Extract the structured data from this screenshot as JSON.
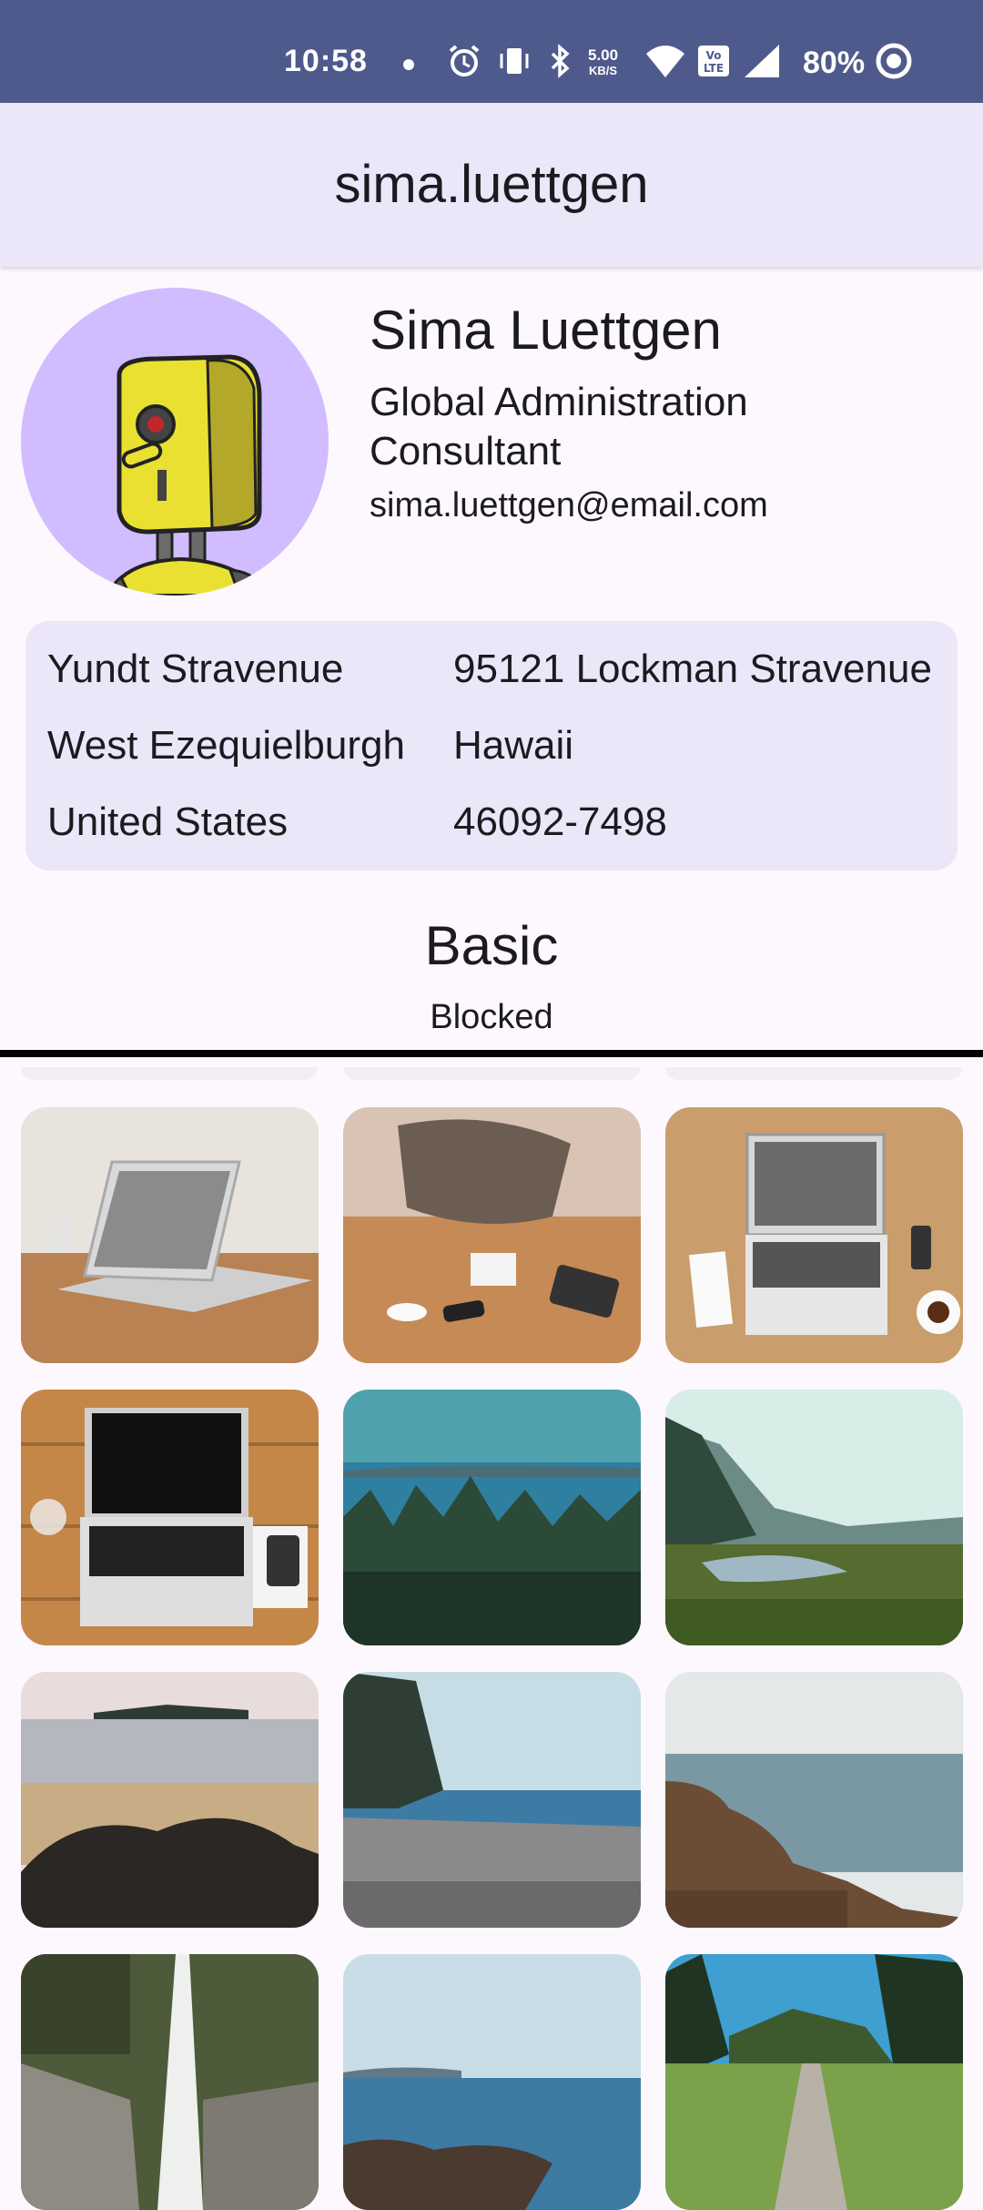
{
  "status_bar": {
    "time": "10:58",
    "speed_value": "5.00",
    "speed_unit": "KB/S",
    "battery": "80%"
  },
  "app_bar": {
    "title": "sima.luettgen"
  },
  "profile": {
    "name": "Sima Luettgen",
    "job_title": "Global Administration Consultant",
    "email": "sima.luettgen@email.com"
  },
  "address": {
    "street_name": "Yundt Stravenue",
    "street_address": "95121 Lockman Stravenue",
    "city": "West Ezequielburgh",
    "state": "Hawaii",
    "country": "United States",
    "zip": "46092-7498"
  },
  "plan": {
    "name": "Basic",
    "status": "Blocked"
  },
  "photos": [
    "laptop on wooden table",
    "people at table with tablet",
    "laptop top view with notebook",
    "laptop on wooden desk",
    "forest and sea",
    "misty river valley",
    "rocky beach",
    "pebble shoreline",
    "rocky coast",
    "waterfall canyon",
    "sea with rocks",
    "forest path"
  ],
  "colors": {
    "status_bar": "#4f5a8c",
    "app_bar": "#ebe6f8",
    "avatar_bg": "#d0bcff",
    "card_bg": "#ebe6f8"
  }
}
